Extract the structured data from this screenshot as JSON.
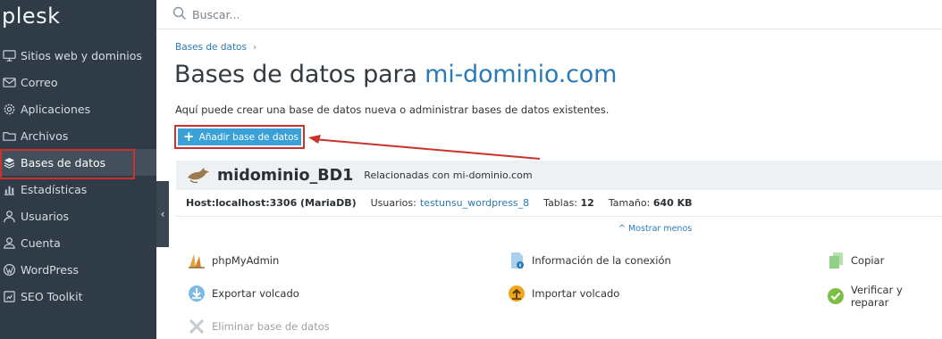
{
  "sidebar": {
    "logo": "plesk",
    "items": [
      {
        "label": "Sitios web y dominios",
        "icon": "monitor-icon"
      },
      {
        "label": "Correo",
        "icon": "mail-icon"
      },
      {
        "label": "Aplicaciones",
        "icon": "gear-icon"
      },
      {
        "label": "Archivos",
        "icon": "folder-icon"
      },
      {
        "label": "Bases de datos",
        "icon": "database-layers-icon",
        "active": true
      },
      {
        "label": "Estadísticas",
        "icon": "bar-chart-icon"
      },
      {
        "label": "Usuarios",
        "icon": "user-icon"
      },
      {
        "label": "Cuenta",
        "icon": "account-icon"
      },
      {
        "label": "WordPress",
        "icon": "wordpress-icon"
      },
      {
        "label": "SEO Toolkit",
        "icon": "seo-toolkit-icon"
      }
    ],
    "collapse_glyph": "‹"
  },
  "search": {
    "placeholder": "Buscar..."
  },
  "breadcrumb": {
    "item": "Bases de datos",
    "separator": "›"
  },
  "page": {
    "title_prefix": "Bases de datos para ",
    "title_domain": "mi-dominio.com",
    "description": "Aquí puede crear una base de datos nueva o administrar bases de datos existentes.",
    "add_button": "Añadir base de datos",
    "add_button_icon": "+"
  },
  "database": {
    "name": "midominio_BD1",
    "related": "Relacionadas con mi-dominio.com",
    "host_label": "Host:",
    "host_value": "localhost:3306 (MariaDB)",
    "users_label": "Usuarios:",
    "users_value": "testunsu_wordpress_8",
    "tables_label": "Tablas:",
    "tables_value": "12",
    "size_label": "Tamaño:",
    "size_value": "640 KB",
    "show_less": "Mostrar menos"
  },
  "actions": [
    {
      "label": "phpMyAdmin",
      "icon": "phpmyadmin-icon"
    },
    {
      "label": "Información de la conexión",
      "icon": "connection-info-icon"
    },
    {
      "label": "Copiar",
      "icon": "copy-icon"
    },
    {
      "label": "Exportar volcado",
      "icon": "export-dump-icon"
    },
    {
      "label": "Importar volcado",
      "icon": "import-dump-icon"
    },
    {
      "label": "Verificar y reparar",
      "icon": "check-repair-icon"
    },
    {
      "label": "Eliminar base de datos",
      "icon": "delete-icon",
      "disabled": true
    }
  ],
  "colors": {
    "sidebar_bg": "#2f3b46",
    "accent": "#2a7ab8",
    "button": "#3aa0d8",
    "highlight_red": "#c9332b"
  }
}
